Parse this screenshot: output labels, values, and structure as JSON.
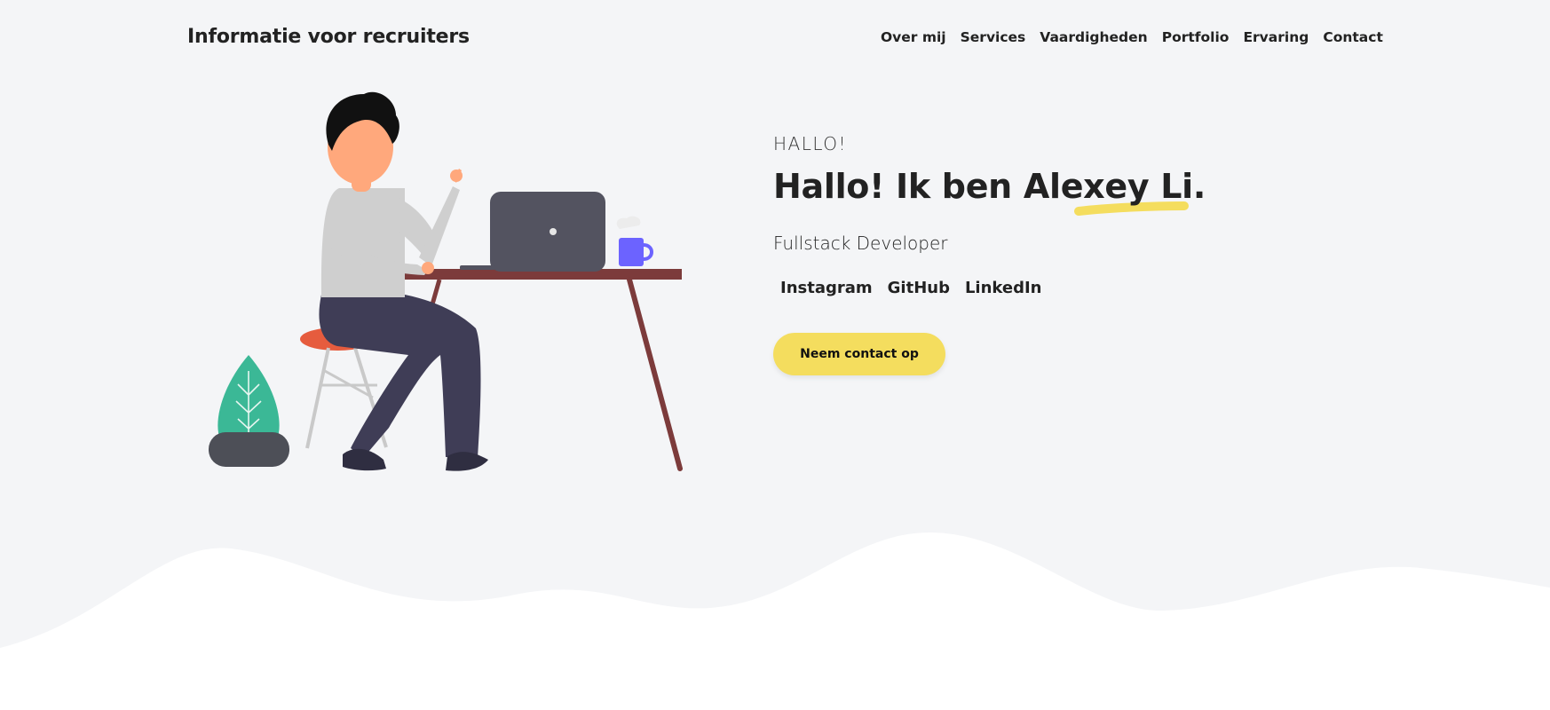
{
  "navbar": {
    "brand": "Informatie voor recruiters",
    "links": [
      "Over mij",
      "Services",
      "Vaardigheden",
      "Portfolio",
      "Ervaring",
      "Contact"
    ]
  },
  "hero": {
    "greeting": "HALLO!",
    "headline": "Hallo! Ik ben Alexey Li.",
    "role": "Fullstack Developer",
    "socials": [
      "Instagram",
      "GitHub",
      "LinkedIn"
    ],
    "cta_label": "Neem contact op"
  },
  "colors": {
    "background": "#f4f5f7",
    "accent_yellow": "#f4dd5e",
    "wave": "#ffffff",
    "desk": "#7c3b3b",
    "laptop": "#535360",
    "mug": "#6c63ff",
    "plant": "#3bb896",
    "pants": "#3f3d56",
    "shirt": "#cfcfcf",
    "skin": "#ffa87c"
  }
}
